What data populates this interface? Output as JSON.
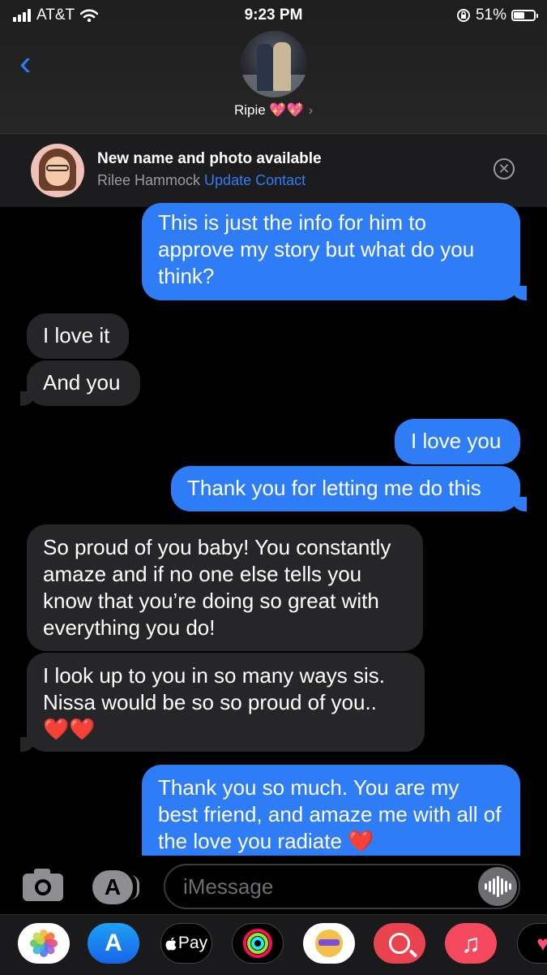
{
  "status": {
    "carrier": "AT&T",
    "time": "9:23 PM",
    "battery": "51%",
    "battery_level": 0.51
  },
  "header": {
    "back_label": "‹",
    "contact_name": "Ripie 💖💖",
    "chevron": "›"
  },
  "banner": {
    "title": "New name and photo available",
    "name": "Rilee Hammock",
    "link": "Update Contact",
    "close": "✕"
  },
  "messages": [
    {
      "from": "me",
      "text": "This is just the info for him to approve my story but what do you think?"
    },
    {
      "from": "them",
      "text": "I love it"
    },
    {
      "from": "them",
      "text": "And you"
    },
    {
      "from": "me",
      "text": "I love you"
    },
    {
      "from": "me",
      "text": "Thank you for letting me do this"
    },
    {
      "from": "them",
      "text": "So proud of you baby! You constantly amaze and if no one else tells you know that you’re doing so great with everything you do!"
    },
    {
      "from": "them",
      "text": "I look up to you in so many ways sis. Nissa would be so so proud of you.. ❤️❤️"
    },
    {
      "from": "me",
      "text": "Thank you so much. You are my best friend, and amaze me with all of the love you radiate ❤️"
    }
  ],
  "input": {
    "placeholder": "iMessage",
    "appstore_glyph": "A"
  },
  "drawer": {
    "appstore_glyph": "A",
    "pay_label": "Pay",
    "music_glyph": "♫",
    "heart_glyph": "♥"
  },
  "colors": {
    "sent": "#2f7df6",
    "received": "#262629",
    "link": "#2f7cf6"
  }
}
